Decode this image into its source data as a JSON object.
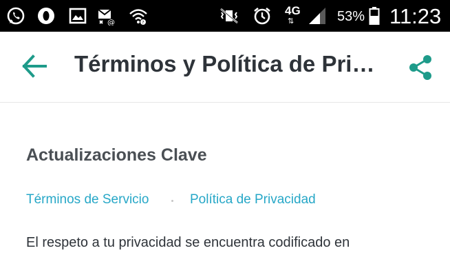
{
  "status_bar": {
    "network": "4G",
    "battery_percent": "53%",
    "time": "11:23",
    "icons": [
      "whatsapp-icon",
      "opera-icon",
      "gallery-icon",
      "missed-email-icon",
      "wifi-icon",
      "mute-icon",
      "alarm-icon",
      "signal-icon",
      "battery-icon"
    ]
  },
  "app_bar": {
    "title": "Términos y Política de Pri…",
    "back_icon": "arrow-left-icon",
    "share_icon": "share-icon",
    "accent_color": "#1e9b8a"
  },
  "content": {
    "heading": "Actualizaciones Clave",
    "links": [
      "Términos de Servicio",
      "Política de Privacidad"
    ],
    "body": "El respeto a tu privacidad se encuentra codificado en",
    "link_color": "#26a7c7"
  }
}
